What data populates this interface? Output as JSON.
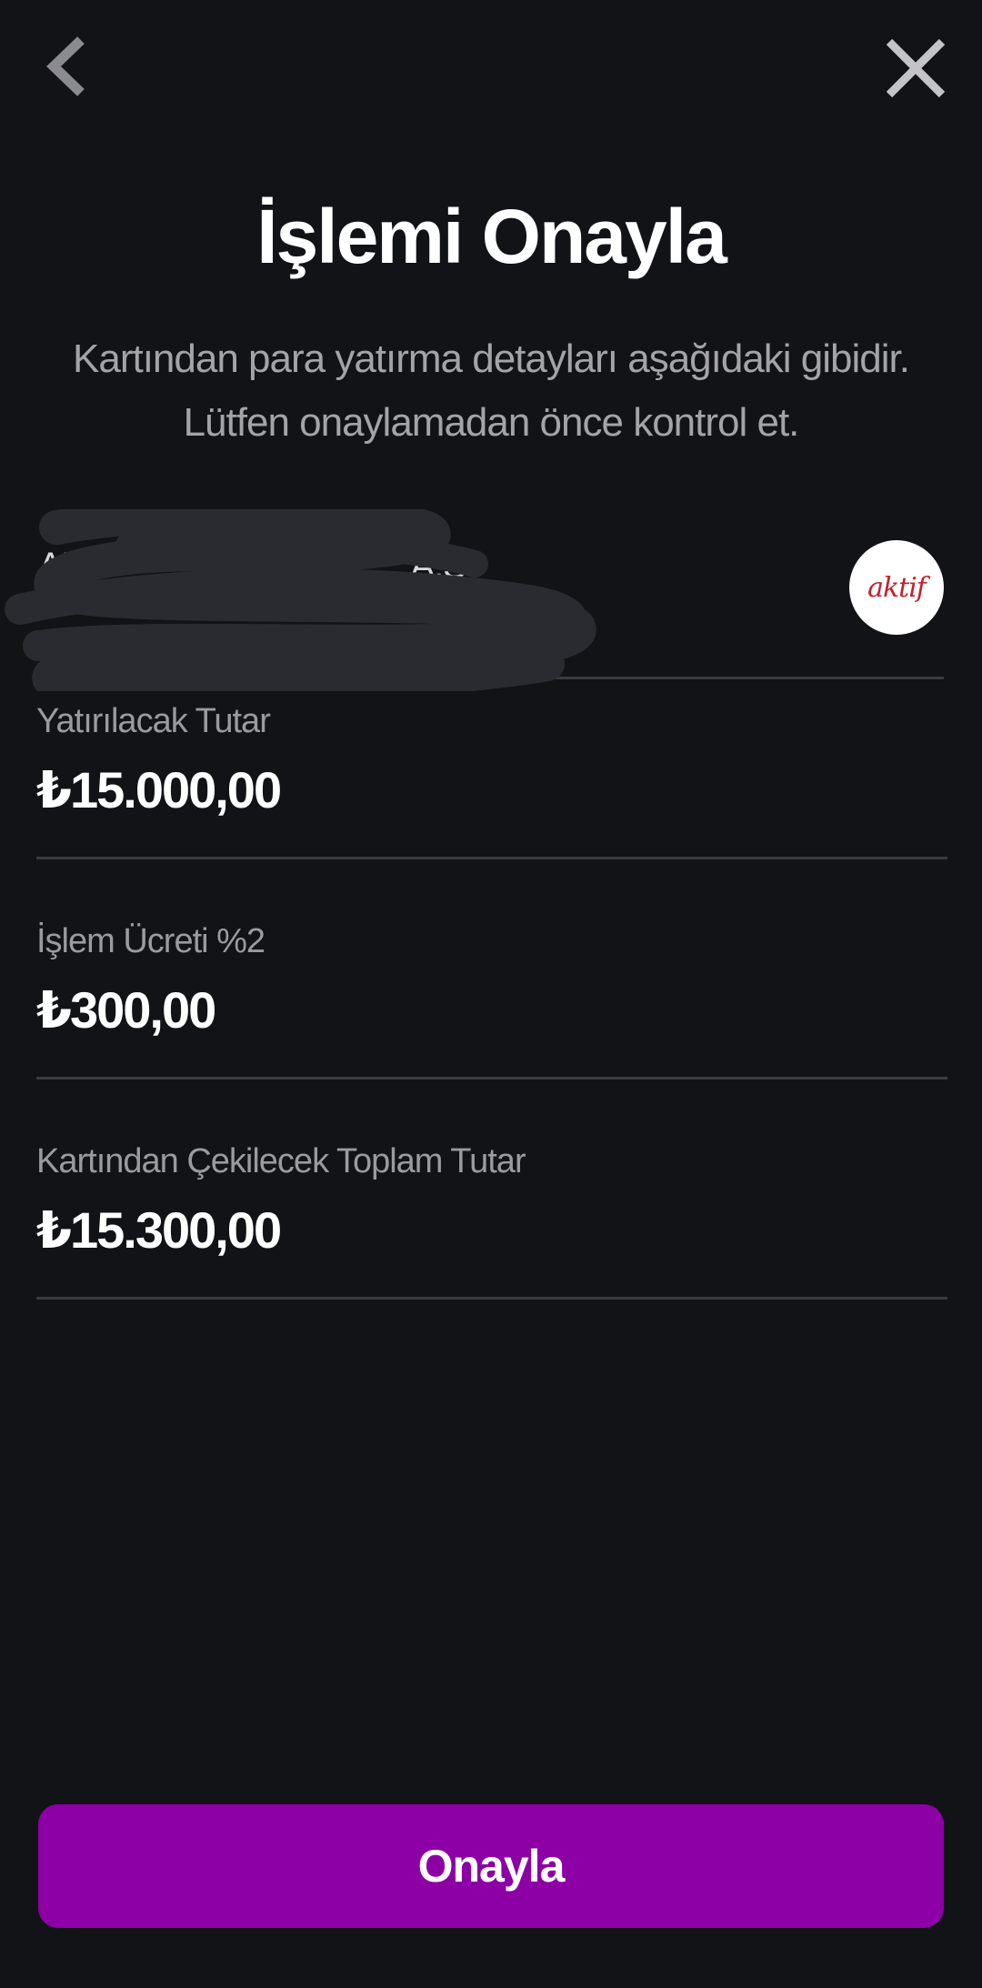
{
  "header": {
    "back_icon": "chevron-left-icon",
    "close_icon": "close-icon"
  },
  "title": "İşlemi Onayla",
  "subtitle_line1": "Kartından para yatırma detayları aşağıdaki gibidir.",
  "subtitle_line2": "Lütfen onaylamadan önce kontrol et.",
  "account": {
    "name": "AK",
    "name_suffix": "A.S",
    "number": "",
    "bank_logo_text": "aktif"
  },
  "details": [
    {
      "label": "Yatırılacak Tutar",
      "value": "₺15.000,00"
    },
    {
      "label": "İşlem Ücreti %2",
      "value": "₺300,00"
    },
    {
      "label": "Kartından Çekilecek Toplam Tutar",
      "value": "₺15.300,00"
    }
  ],
  "confirm_button": "Onayla",
  "colors": {
    "background": "#121317",
    "accent": "#8c00a5",
    "divider": "#3a3b40"
  }
}
